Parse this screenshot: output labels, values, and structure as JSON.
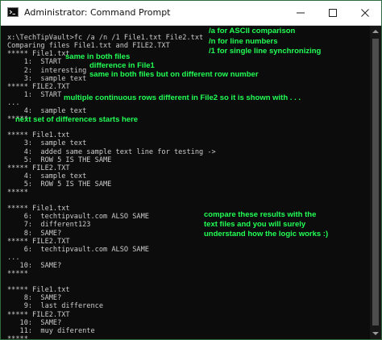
{
  "window": {
    "title": "Administrator: Command Prompt",
    "icon": "cmd-icon",
    "controls": [
      "minimize-icon",
      "maximize-icon",
      "close-icon"
    ]
  },
  "console_lines": [
    "",
    "x:\\TechTipVault>fc /a /n /1 File1.txt File2.txt",
    "Comparing files File1.txt and FILE2.TXT",
    "***** File1.txt",
    "    1:  START",
    "    2:  interesting",
    "    3:  sample text",
    "***** FILE2.TXT",
    "    1:  START",
    "...",
    "    4:  sample text",
    "*****",
    "",
    "***** File1.txt",
    "    3:  sample text",
    "    4:  added same sample text line for testing ->",
    "    5:  ROW 5 IS THE SAME",
    "***** FILE2.TXT",
    "    4:  sample text",
    "    5:  ROW 5 IS THE SAME",
    "*****",
    "",
    "***** File1.txt",
    "    6:  techtipvault.com ALSO SAME",
    "    7:  different123",
    "    8:  SAME?",
    "***** FILE2.TXT",
    "    6:  techtipvault.com ALSO SAME",
    "...",
    "   10:  SAME?",
    "*****",
    "",
    "***** File1.txt",
    "    8:  SAME?",
    "    9:  last difference",
    "***** FILE2.TXT",
    "   10:  SAME?",
    "   11:  muy diferente",
    "*****"
  ],
  "annotations": {
    "ascii": "/a for ASCII comparison",
    "numbers": "/n for line numbers",
    "sync": "/1 for single line synchronizing",
    "same_both": "same in both files",
    "interesting_diff": "difference in File1",
    "different_row": "same in both files but on different row number",
    "continuous": "multiple continuous rows different in File2 so it is shown with . . .",
    "next_set": "next set of differences starts here",
    "compare1": "compare these results with the",
    "compare2": "text files and you will surely",
    "compare3": "understand how the logic works :)"
  },
  "colors": {
    "console_bg": "#0c0c0c",
    "console_text": "#cccccc",
    "annotation": "#22ff55",
    "titlebar": "#ffffff"
  }
}
